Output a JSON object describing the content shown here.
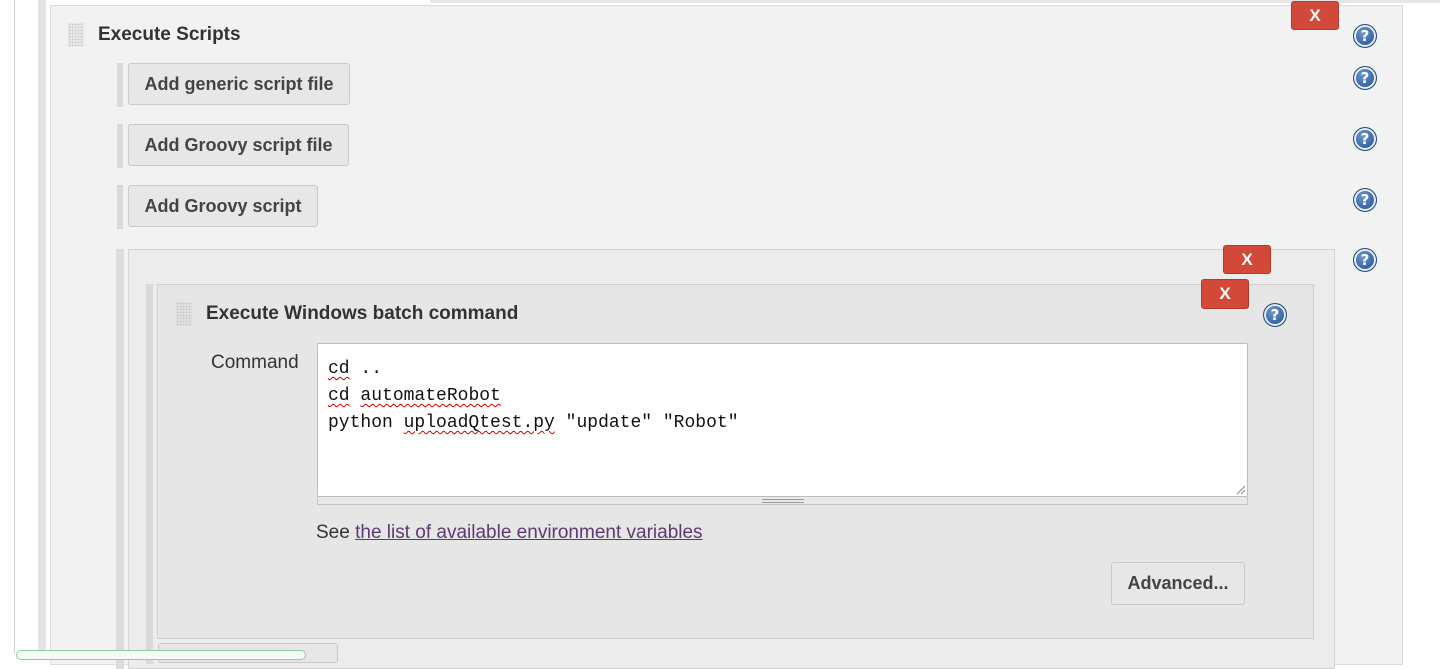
{
  "execute_scripts": {
    "title": "Execute Scripts",
    "delete_label": "X",
    "buttons": {
      "add_generic_script_file": "Add generic script file",
      "add_groovy_script_file": "Add Groovy script file",
      "add_groovy_script": "Add Groovy script"
    }
  },
  "inner_step": {
    "delete_label": "X"
  },
  "windows_batch": {
    "title": "Execute Windows batch command",
    "delete_label": "X",
    "command_label": "Command",
    "command_lines": [
      {
        "words": [
          "cd",
          " .."
        ]
      },
      {
        "words": [
          "cd",
          " ",
          "automateRobot"
        ]
      },
      {
        "words": [
          "python ",
          "uploadQtest.py",
          " \"update\" \"Robot\""
        ]
      }
    ],
    "see_prefix": "See ",
    "env_vars_link": "the list of available environment variables",
    "advanced_button": "Advanced..."
  },
  "icons": {
    "help": "help-icon",
    "drag": "drag-handle-icon",
    "resize": "resize-grip-icon"
  },
  "colors": {
    "delete_red": "#d24939",
    "help_blue": "#3b6aa8",
    "link_purple": "#5d3a72"
  }
}
